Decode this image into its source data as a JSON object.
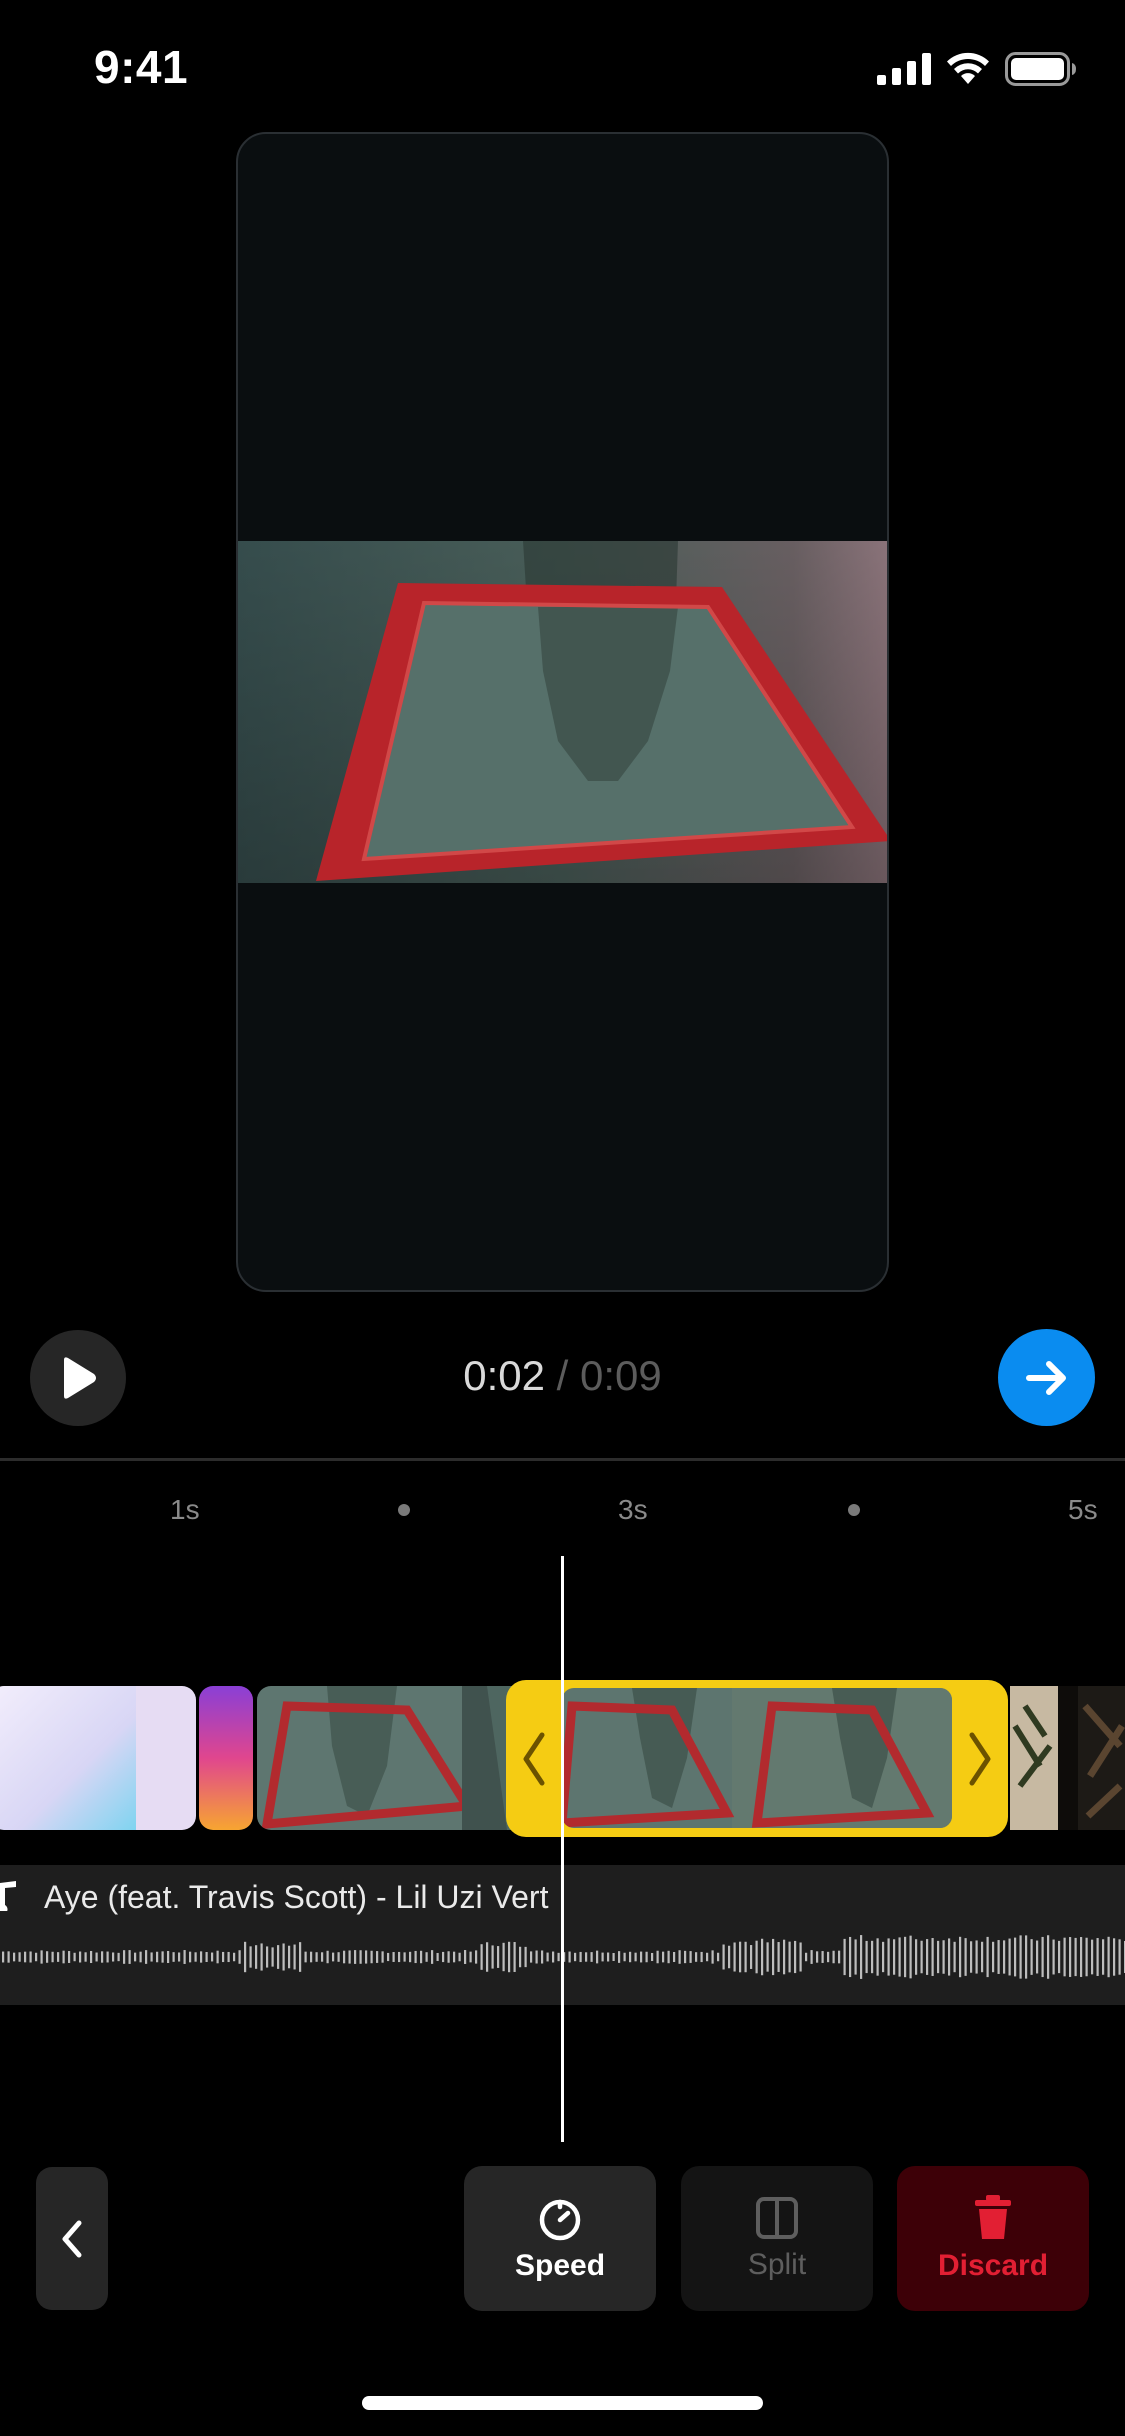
{
  "status_bar": {
    "time": "9:41",
    "icons": [
      "cellular-signal-icon",
      "wifi-icon",
      "battery-icon"
    ]
  },
  "preview": {
    "image": "red frame floating in water with reflection"
  },
  "player": {
    "current_time": "0:02",
    "separator": "/",
    "total_time": "0:09",
    "progress": 0.22,
    "play_icon": "play-icon",
    "next_icon": "arrow-right-icon"
  },
  "ruler": {
    "labels": [
      "1s",
      "3s",
      "5s"
    ]
  },
  "audio": {
    "title": "Aye (feat. Travis Scott) - Lil Uzi Vert",
    "icon": "music-note-icon"
  },
  "toolbar": {
    "back_icon": "chevron-left-icon",
    "speed_label": "Speed",
    "split_label": "Split",
    "discard_label": "Discard"
  },
  "colors": {
    "accent_blue": "#0a8cf0",
    "trim_yellow": "#f5cc13",
    "discard_red": "#e21f33"
  }
}
